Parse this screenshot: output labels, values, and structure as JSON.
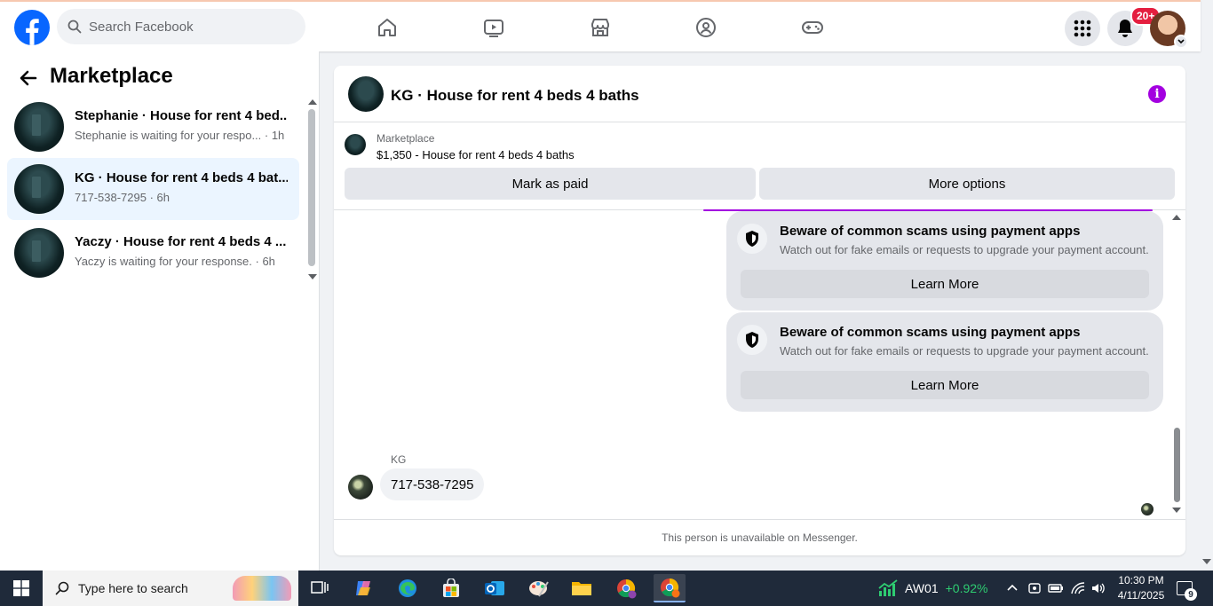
{
  "topbar": {
    "search_placeholder": "Search Facebook",
    "notification_badge": "20+",
    "nav_icons": [
      "home-icon",
      "watch-icon",
      "marketplace-icon",
      "groups-icon",
      "gaming-icon"
    ]
  },
  "sidebar": {
    "title": "Marketplace",
    "conversations": [
      {
        "title": "Stephanie · House for rent 4 bed...",
        "subtitle": "Stephanie is waiting for your respo... · 1h",
        "active": false
      },
      {
        "title": "KG · House for rent 4 beds 4 bat...",
        "subtitle": "717-538-7295 · 6h",
        "active": true
      },
      {
        "title": "Yaczy · House for rent 4 beds 4 ...",
        "subtitle": "Yaczy is waiting for your response. · 6h",
        "active": false
      }
    ]
  },
  "chat": {
    "header_title": "KG · House for rent 4 beds 4 baths",
    "listing": {
      "kicker": "Marketplace",
      "price_title": "$1,350 - House for rent 4 beds 4 baths",
      "mark_paid_label": "Mark as paid",
      "more_options_label": "More options"
    },
    "scam_cards": [
      {
        "title": "Beware of common scams using payment apps",
        "body": "Watch out for fake emails or requests to upgrade your payment account.",
        "button": "Learn More"
      },
      {
        "title": "Beware of common scams using payment apps",
        "body": "Watch out for fake emails or requests to upgrade your payment account.",
        "button": "Learn More"
      }
    ],
    "sender_name": "KG",
    "message": "717-538-7295",
    "footer_note": "This person is unavailable on Messenger.",
    "accent_color": "#a300e0"
  },
  "taskbar": {
    "search_placeholder": "Type here to search",
    "stock_symbol": "AW01",
    "stock_change": "+0.92%",
    "time": "10:30 PM",
    "date": "4/11/2025",
    "notification_count": "9"
  }
}
